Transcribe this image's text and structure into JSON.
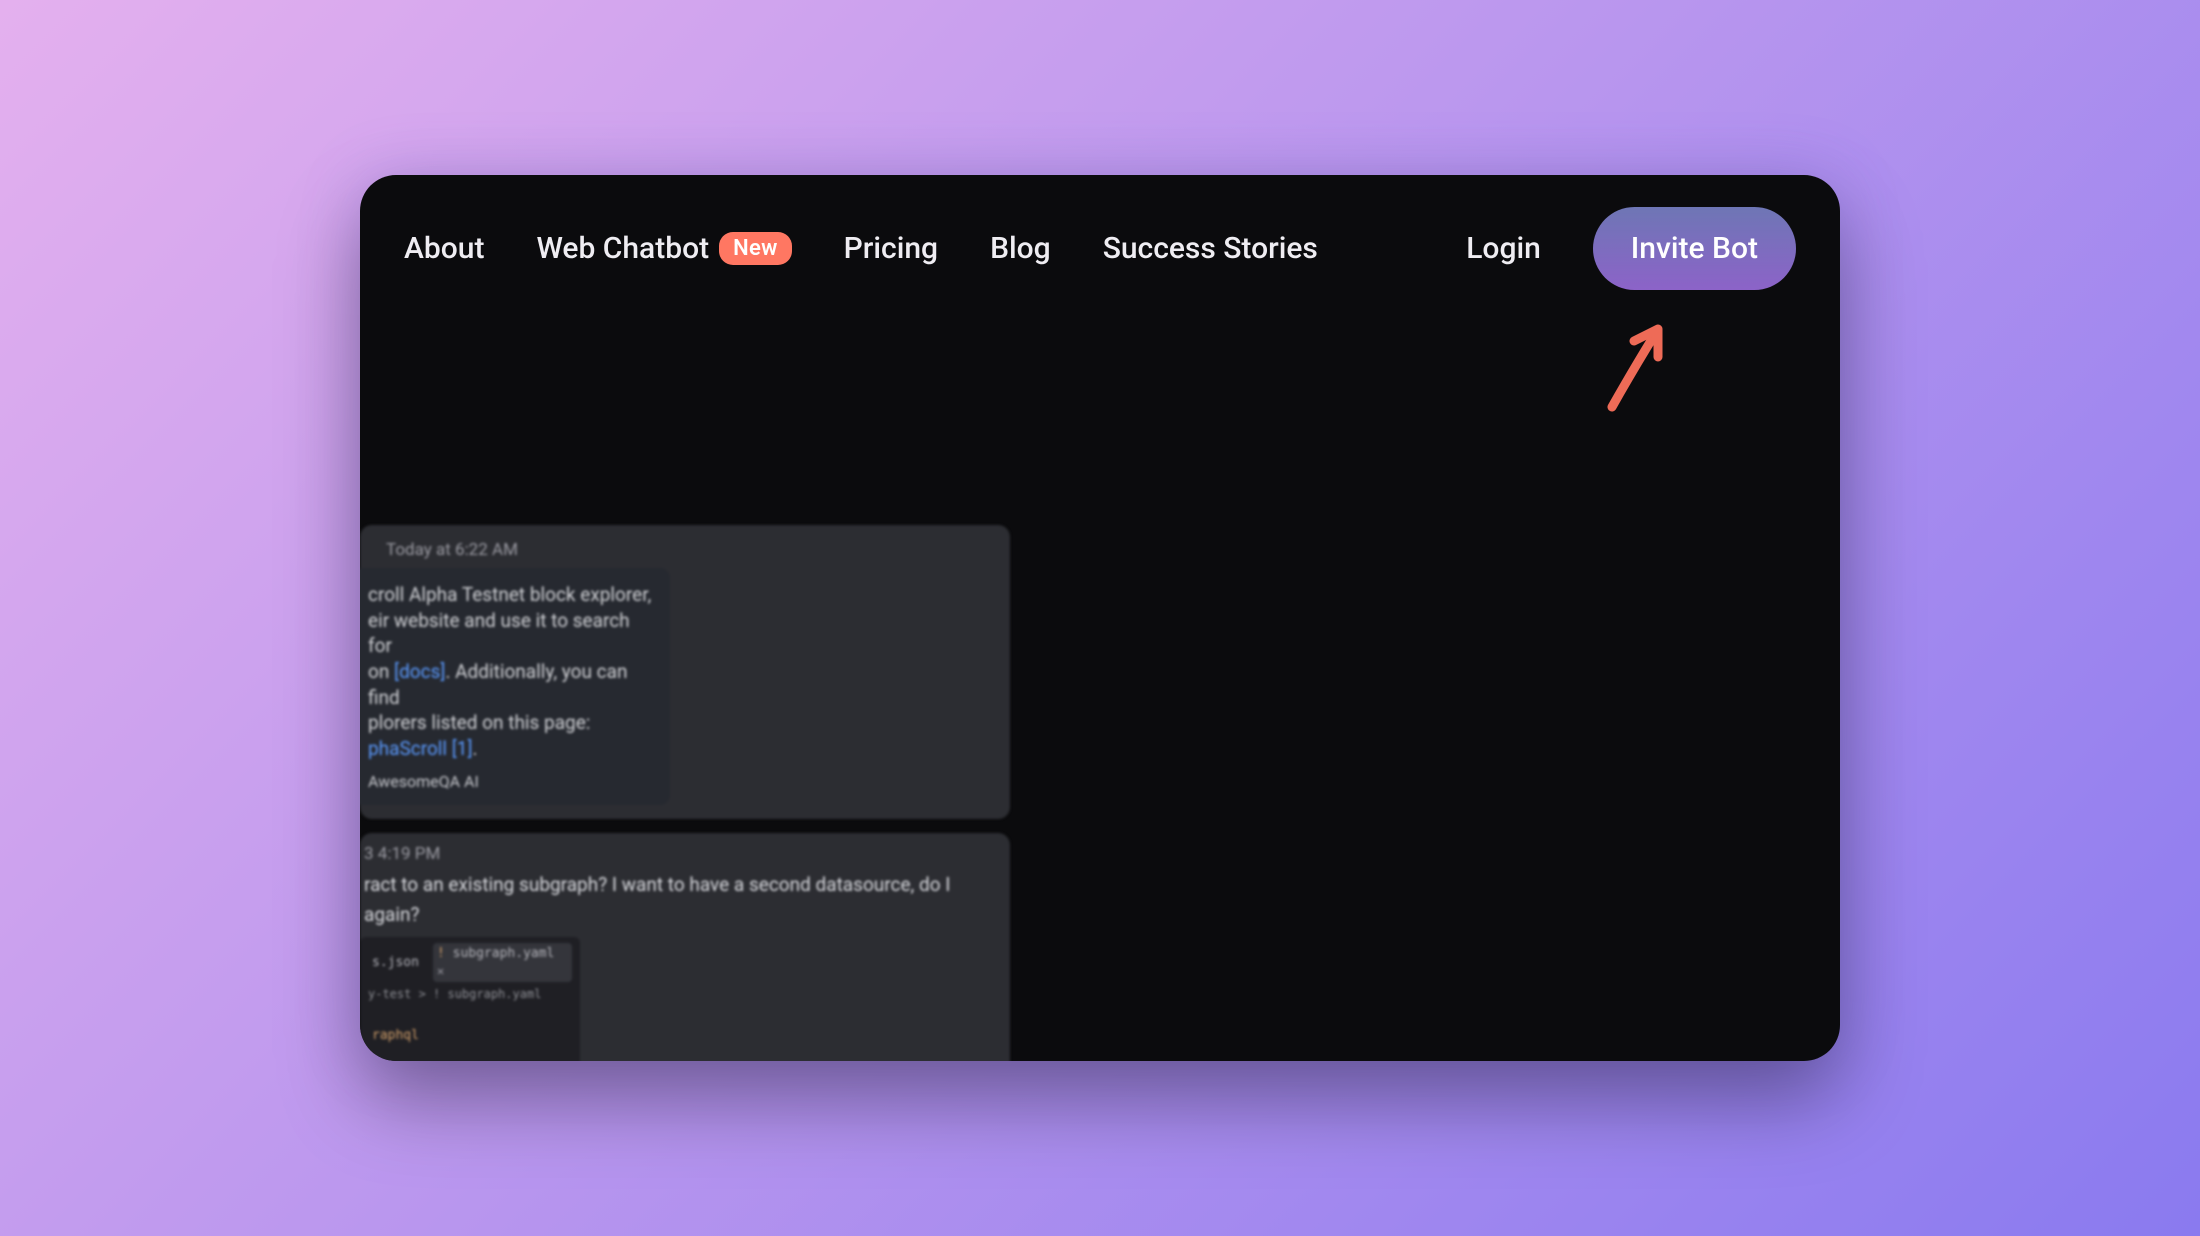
{
  "nav": {
    "about": "About",
    "web_chatbot": "Web Chatbot",
    "web_chatbot_badge": "New",
    "pricing": "Pricing",
    "blog": "Blog",
    "success_stories": "Success Stories",
    "login": "Login",
    "invite_bot": "Invite Bot"
  },
  "colors": {
    "accent_button_from": "#6e76b5",
    "accent_button_to": "#8c63c8",
    "badge": "#ff7762",
    "link": "#5a9aff",
    "arrow": "#ee6b57"
  },
  "chat": {
    "card1": {
      "timestamp": "Today at 6:22 AM",
      "line1_a": "croll Alpha Testnet block explorer,",
      "line2_a": "eir website and use it to search for",
      "line3_prefix": "on ",
      "line3_link": "[docs]",
      "line3_suffix": ". Additionally, you can find",
      "line4": "plorers listed on this page:",
      "line5_link": "phaScroll [1]",
      "line5_suffix": ".",
      "footer": "AwesomeQA AI"
    },
    "card2": {
      "timestamp": "3 4:19 PM",
      "msg_a": "ract to an existing subgraph? I want to have a second datasource, do I",
      "msg_b": "again?",
      "code": {
        "tab1": "s.json",
        "tab2": "subgraph.yaml",
        "crumb": "y-test  >  !  subgraph.yaml",
        "lang_line": "raphql"
      }
    }
  }
}
